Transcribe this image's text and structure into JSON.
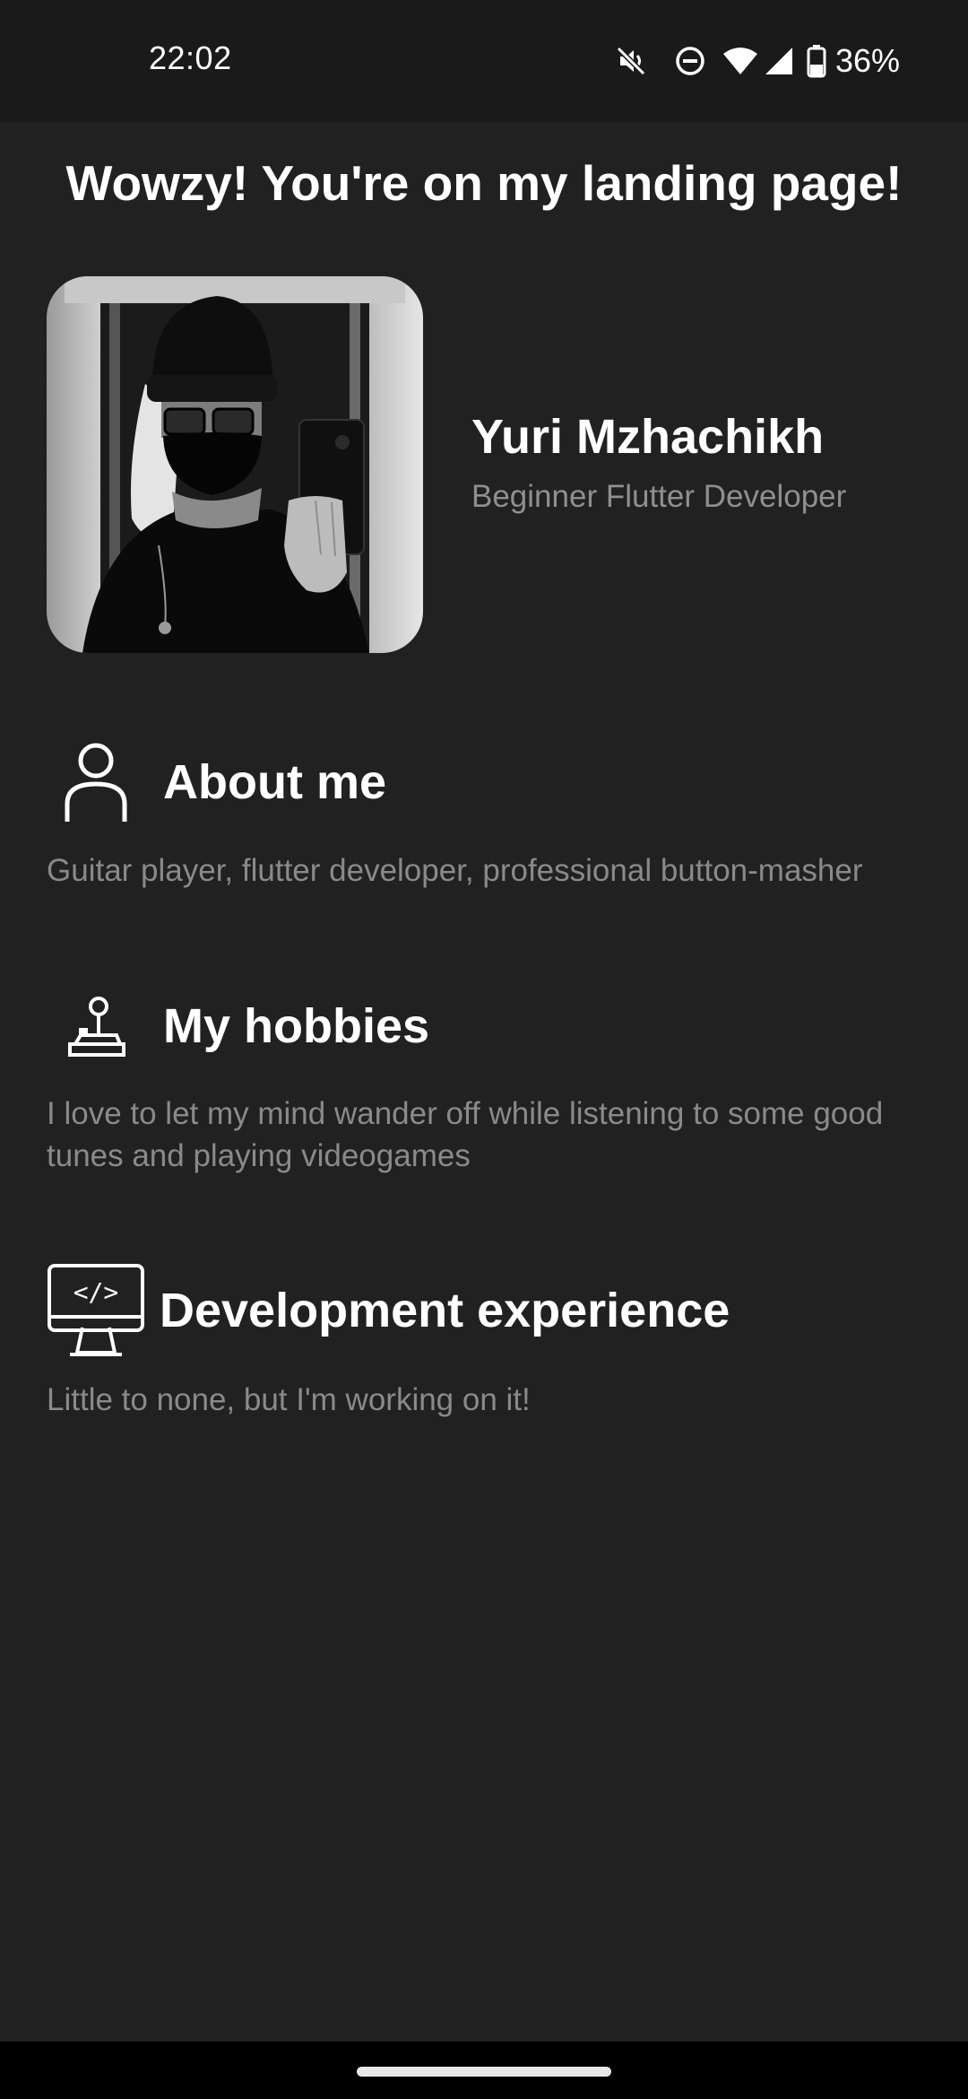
{
  "status_bar": {
    "time": "22:02",
    "battery": "36%",
    "icons": [
      "mute-icon",
      "dnd-icon",
      "wifi-icon",
      "signal-icon",
      "battery-icon"
    ]
  },
  "page": {
    "title": "Wowzy! You're on my landing page!"
  },
  "profile": {
    "name": "Yuri Mzhachikh",
    "role": "Beginner Flutter Developer"
  },
  "sections": [
    {
      "icon": "person-icon",
      "title": "About me",
      "text": "Guitar player, flutter developer, professional button-masher"
    },
    {
      "icon": "joystick-icon",
      "title": "My hobbies",
      "text": "I love to let my mind wander off while listening to some good tunes and playing videogames"
    },
    {
      "icon": "code-monitor-icon",
      "title": "Development experience",
      "text": "Little to none, but I'm working on it!"
    }
  ],
  "colors": {
    "background": "#212121",
    "status_bar": "#1a1a1a",
    "text_primary": "#ffffff",
    "text_secondary": "#8a8a8a"
  }
}
